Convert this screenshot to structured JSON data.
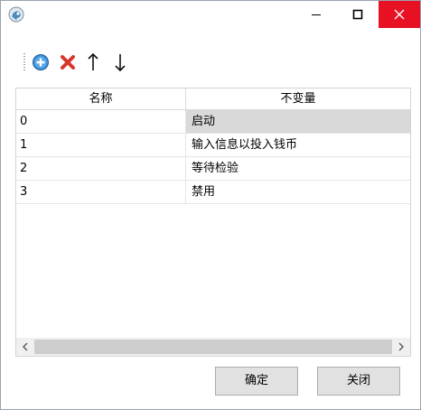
{
  "window": {
    "icon": "app-head-icon",
    "controls": {
      "minimize": "minimize-icon",
      "maximize": "maximize-icon",
      "close": "close-icon",
      "close_color": "#e81123"
    }
  },
  "toolbar": {
    "add_icon": "add-circle-icon",
    "delete_icon": "delete-x-icon",
    "up_icon": "arrow-up-icon",
    "down_icon": "arrow-down-icon"
  },
  "table": {
    "headers": [
      "名称",
      "不变量"
    ],
    "rows": [
      {
        "name": "0",
        "invariant": "启动",
        "selected": true
      },
      {
        "name": "1",
        "invariant": "输入信息以投入钱币",
        "selected": false
      },
      {
        "name": "2",
        "invariant": "等待检验",
        "selected": false
      },
      {
        "name": "3",
        "invariant": "禁用",
        "selected": false
      }
    ],
    "selected_color": "#d9d9d9"
  },
  "buttons": {
    "ok": "确定",
    "close": "关闭"
  }
}
